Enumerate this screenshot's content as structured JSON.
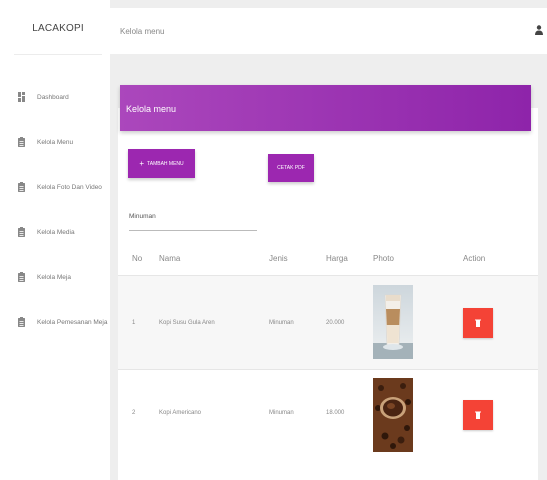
{
  "sidebar": {
    "brand": "LACAKOPI",
    "items": [
      {
        "label": "Dashboard",
        "icon": "dashboard-icon"
      },
      {
        "label": "Kelola Menu",
        "icon": "clipboard-icon"
      },
      {
        "label": "Kelola Foto Dan Video",
        "icon": "clipboard-icon"
      },
      {
        "label": "Kelola Media",
        "icon": "clipboard-icon"
      },
      {
        "label": "Kelola Meja",
        "icon": "clipboard-icon"
      },
      {
        "label": "Kelola Pemesanan Meja",
        "icon": "clipboard-icon"
      }
    ]
  },
  "topbar": {
    "title": "Kelola menu",
    "user_icon": "user-icon"
  },
  "card": {
    "title": "Kelola menu",
    "add_button": "TAMBAH MENU",
    "add_icon": "+",
    "print_button": "CETAK PDF",
    "filter_value": "Minuman"
  },
  "table": {
    "headers": [
      "No",
      "Nama",
      "Jenis",
      "Harga",
      "Photo",
      "Action"
    ],
    "rows": [
      {
        "no": "1",
        "nama": "Kopi Susu Gula Aren",
        "jenis": "Minuman",
        "harga": "20.000"
      },
      {
        "no": "2",
        "nama": "Kopi Americano",
        "jenis": "Minuman",
        "harga": "18.000"
      }
    ]
  },
  "colors": {
    "header_gradient_start": "#ab47bc",
    "header_gradient_end": "#8e24aa",
    "button_purple": "#9c27b0",
    "delete_red": "#f44336"
  }
}
